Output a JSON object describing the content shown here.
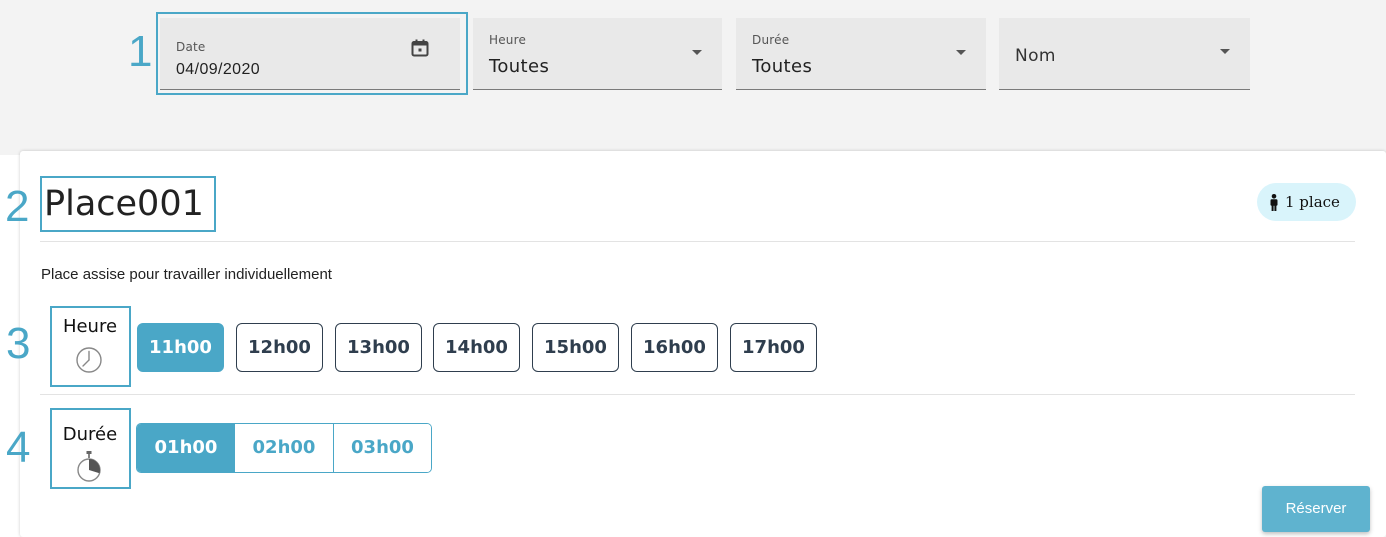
{
  "colors": {
    "accent": "#4aa7c7",
    "badge_bg": "#d9f4fb",
    "filter_bg": "#f3f3f3",
    "field_bg": "#e9e9e9",
    "button_dark": "#2f3e4e",
    "reserve_bg": "#5fb3cf"
  },
  "annotations": [
    "1",
    "2",
    "3",
    "4"
  ],
  "filters": {
    "date": {
      "label": "Date",
      "value": "04/09/2020",
      "icon": "calendar-icon"
    },
    "heure": {
      "label": "Heure",
      "value": "Toutes",
      "icon": "caret-down-icon"
    },
    "duree": {
      "label": "Durée",
      "value": "Toutes",
      "icon": "caret-down-icon"
    },
    "nom": {
      "placeholder": "Nom",
      "icon": "caret-down-icon"
    }
  },
  "place": {
    "title": "Place001",
    "badge": "1 place",
    "badge_icon": "person-icon",
    "description": "Place assise pour travailler individuellement"
  },
  "heure": {
    "label": "Heure",
    "icon": "clock-icon",
    "options": [
      "11h00",
      "12h00",
      "13h00",
      "14h00",
      "15h00",
      "16h00",
      "17h00"
    ],
    "selected": "11h00"
  },
  "duree": {
    "label": "Durée",
    "icon": "stopwatch-icon",
    "options": [
      "01h00",
      "02h00",
      "03h00"
    ],
    "selected": "01h00"
  },
  "actions": {
    "reserve_label": "Réserver"
  }
}
